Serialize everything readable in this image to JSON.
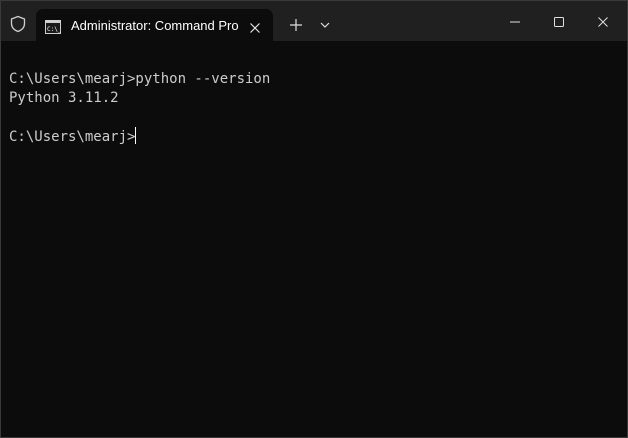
{
  "titlebar": {
    "tab_title": "Administrator: Command Pro",
    "admin_icon": "shield-icon",
    "tab_icon": "command-prompt-icon"
  },
  "window_controls": [
    "minimize-icon",
    "maximize-icon",
    "close-icon"
  ],
  "terminal": {
    "lines": [
      "C:\\Users\\mearj>python --version",
      "Python 3.11.2",
      "",
      "C:\\Users\\mearj>"
    ],
    "foreground": "#cccccc",
    "background": "#0c0c0c"
  }
}
